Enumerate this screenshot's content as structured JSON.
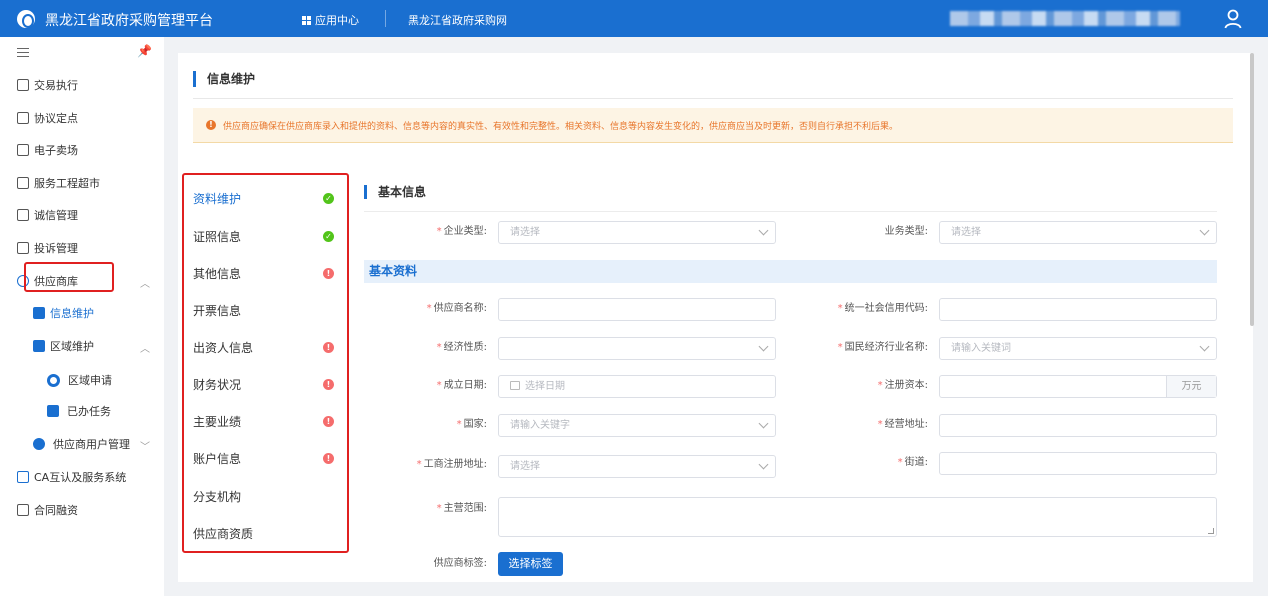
{
  "topbar": {
    "title": "黑龙江省政府采购管理平台",
    "app_center": "应用中心",
    "site_link": "黑龙江省政府采购网"
  },
  "sidebar": {
    "items": [
      {
        "label": "交易执行"
      },
      {
        "label": "协议定点"
      },
      {
        "label": "电子卖场"
      },
      {
        "label": "服务工程超市"
      },
      {
        "label": "诚信管理"
      },
      {
        "label": "投诉管理"
      },
      {
        "label": "供应商库"
      },
      {
        "label": "信息维护"
      },
      {
        "label": "区域维护"
      },
      {
        "label": "区域申请"
      },
      {
        "label": "已办任务"
      },
      {
        "label": "供应商用户管理"
      },
      {
        "label": "CA互认及服务系统"
      },
      {
        "label": "合同融资"
      }
    ]
  },
  "page": {
    "title": "信息维护",
    "notice": "供应商应确保在供应商库录入和提供的资料、信息等内容的真实性、有效性和完整性。相关资料、信息等内容发生变化的，供应商应当及时更新，否则自行承担不利后果。"
  },
  "left_nav": {
    "items": [
      {
        "label": "资料维护",
        "status": "ok"
      },
      {
        "label": "证照信息",
        "status": "ok"
      },
      {
        "label": "其他信息",
        "status": "error"
      },
      {
        "label": "开票信息",
        "status": ""
      },
      {
        "label": "出资人信息",
        "status": "error"
      },
      {
        "label": "财务状况",
        "status": "error"
      },
      {
        "label": "主要业绩",
        "status": "error"
      },
      {
        "label": "账户信息",
        "status": "error"
      },
      {
        "label": "分支机构",
        "status": ""
      },
      {
        "label": "供应商资质",
        "status": ""
      }
    ]
  },
  "form": {
    "basic_info_title": "基本信息",
    "basic_data_title": "基本资料",
    "enterprise_type": {
      "label": "企业类型:",
      "placeholder": "请选择"
    },
    "business_type": {
      "label": "业务类型:",
      "placeholder": "请选择"
    },
    "supplier_name": {
      "label": "供应商名称:",
      "value": ""
    },
    "credit_code": {
      "label": "统一社会信用代码:",
      "value": ""
    },
    "economic_nature": {
      "label": "经济性质:",
      "value": ""
    },
    "industry_name": {
      "label": "国民经济行业名称:",
      "placeholder": "请输入关键词"
    },
    "founded_date": {
      "label": "成立日期:",
      "placeholder": "选择日期"
    },
    "registered_capital": {
      "label": "注册资本:",
      "unit": "万元"
    },
    "country": {
      "label": "国家:",
      "placeholder": "请输入关键字"
    },
    "business_address": {
      "label": "经营地址:",
      "value": ""
    },
    "registered_address": {
      "label": "工商注册地址:",
      "placeholder": "请选择"
    },
    "street": {
      "label": "街道:",
      "value": ""
    },
    "business_scope": {
      "label": "主营范围:",
      "value": ""
    },
    "supplier_tag": {
      "label": "供应商标签:",
      "button": "选择标签"
    }
  },
  "colors": {
    "primary": "#1a6fd0",
    "highlight_border": "#e02020",
    "ok": "#52c41a",
    "error": "#f56c6c",
    "notice_text": "#e8762c"
  }
}
